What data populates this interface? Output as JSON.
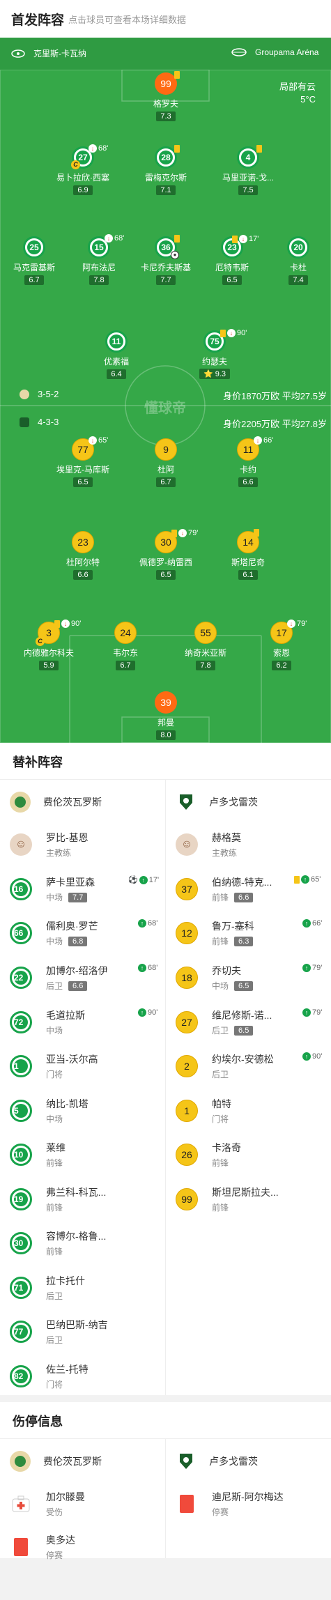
{
  "header": {
    "title": "首发阵容",
    "hint": "点击球员可查看本场详细数据"
  },
  "pitch": {
    "home_team": "克里斯-卡瓦纳",
    "venue": "Groupama Aréna",
    "weather": "局部有云",
    "temperature": "5°C",
    "watermark": "懂球帝",
    "home_formation": "3-5-2",
    "home_value": "身价1870万欧 平均27.5岁",
    "away_formation": "4-3-3",
    "away_value": "身价2205万欧 平均27.8岁",
    "colors": {
      "grass": "#35a848",
      "home": "#17a34a",
      "away": "#f5c518",
      "gk_away": "#ff6a13"
    }
  },
  "home_players": [
    {
      "num": "99",
      "name": "格罗夫",
      "rating": "7.3",
      "gk": true,
      "card": "yellow"
    },
    {
      "num": "27",
      "name": "易卜拉欣·西塞",
      "rating": "6.9",
      "sub": "68'",
      "captain": true
    },
    {
      "num": "28",
      "name": "雷梅克尔斯",
      "rating": "7.1",
      "card": "yellow"
    },
    {
      "num": "4",
      "name": "马里亚诺-戈...",
      "rating": "7.5",
      "card": "yellow"
    },
    {
      "num": "25",
      "name": "马克雷基斯",
      "rating": "6.7"
    },
    {
      "num": "15",
      "name": "阿布法尼",
      "rating": "7.8",
      "sub": "68'"
    },
    {
      "num": "36",
      "name": "卡尼乔夫斯基",
      "rating": "7.7",
      "card": "yellow",
      "goal": true
    },
    {
      "num": "23",
      "name": "厄特韦斯",
      "rating": "6.5",
      "card": "yellow",
      "sub": "17'"
    },
    {
      "num": "20",
      "name": "卡杜",
      "rating": "7.4"
    },
    {
      "num": "11",
      "name": "优素福",
      "rating": "6.4"
    },
    {
      "num": "75",
      "name": "约瑟夫",
      "rating": "9.3",
      "card": "yellow",
      "sub": "90'",
      "star": true
    }
  ],
  "away_players": [
    {
      "num": "77",
      "name": "埃里克-马库斯",
      "rating": "6.5",
      "sub": "65'"
    },
    {
      "num": "9",
      "name": "杜阿",
      "rating": "6.7"
    },
    {
      "num": "11",
      "name": "卡约",
      "rating": "6.6",
      "sub": "66'"
    },
    {
      "num": "23",
      "name": "杜阿尔特",
      "rating": "6.6"
    },
    {
      "num": "30",
      "name": "佩德罗-纳雷西",
      "rating": "6.5",
      "card": "yellow",
      "sub": "79'"
    },
    {
      "num": "14",
      "name": "斯塔尼奇",
      "rating": "6.1",
      "card": "yellow"
    },
    {
      "num": "3",
      "name": "内德雅尔科夫",
      "rating": "5.9",
      "card": "yellow",
      "sub": "90'",
      "captain": true
    },
    {
      "num": "24",
      "name": "韦尔东",
      "rating": "6.7"
    },
    {
      "num": "55",
      "name": "纳奇米亚斯",
      "rating": "7.8"
    },
    {
      "num": "17",
      "name": "索恩",
      "rating": "6.2",
      "sub": "79'"
    },
    {
      "num": "39",
      "name": "邦曼",
      "rating": "8.0",
      "gk": true
    }
  ],
  "subs": {
    "title": "替补阵容",
    "home_team": "费伦茨瓦罗斯",
    "away_team": "卢多戈雷茨",
    "home_coach": {
      "name": "罗比-基恩",
      "role": "主教练"
    },
    "away_coach": {
      "name": "赫格莫",
      "role": "主教练"
    },
    "home": [
      {
        "num": "16",
        "name": "萨卡里亚森",
        "pos": "中场",
        "rating": "7.7",
        "event": "17'",
        "goal": true
      },
      {
        "num": "66",
        "name": "儒利奥·罗芒",
        "pos": "中场",
        "rating": "6.8",
        "event": "68'"
      },
      {
        "num": "22",
        "name": "加博尔-绍洛伊",
        "pos": "后卫",
        "rating": "6.6",
        "event": "68'"
      },
      {
        "num": "72",
        "name": "毛道拉斯",
        "pos": "中场",
        "rating": "",
        "event": "90'"
      },
      {
        "num": "1",
        "name": "亚当-沃尔高",
        "pos": "门将",
        "rating": ""
      },
      {
        "num": "5",
        "name": "纳比-凯塔",
        "pos": "中场",
        "rating": ""
      },
      {
        "num": "10",
        "name": "莱维",
        "pos": "前锋",
        "rating": ""
      },
      {
        "num": "19",
        "name": "弗兰科-科瓦...",
        "pos": "前锋",
        "rating": ""
      },
      {
        "num": "30",
        "name": "容博尔-格鲁...",
        "pos": "前锋",
        "rating": ""
      },
      {
        "num": "71",
        "name": "拉卡托什",
        "pos": "后卫",
        "rating": ""
      },
      {
        "num": "77",
        "name": "巴纳巴斯-纳吉",
        "pos": "后卫",
        "rating": ""
      },
      {
        "num": "82",
        "name": "佐兰-托特",
        "pos": "门将",
        "rating": ""
      }
    ],
    "away": [
      {
        "num": "37",
        "name": "伯纳德-特克...",
        "pos": "前锋",
        "rating": "6.6",
        "event": "65'",
        "card": "yellow"
      },
      {
        "num": "12",
        "name": "鲁万-塞科",
        "pos": "前锋",
        "rating": "6.3",
        "event": "66'"
      },
      {
        "num": "18",
        "name": "乔切夫",
        "pos": "中场",
        "rating": "6.5",
        "event": "79'"
      },
      {
        "num": "27",
        "name": "维尼修斯-诺...",
        "pos": "后卫",
        "rating": "6.5",
        "event": "79'"
      },
      {
        "num": "2",
        "name": "约埃尔-安德松",
        "pos": "后卫",
        "rating": "",
        "event": "90'"
      },
      {
        "num": "1",
        "name": "帕特",
        "pos": "门将",
        "rating": ""
      },
      {
        "num": "26",
        "name": "卡洛奇",
        "pos": "前锋",
        "rating": ""
      },
      {
        "num": "99",
        "name": "斯坦尼斯拉夫...",
        "pos": "前锋",
        "rating": ""
      }
    ]
  },
  "injuries": {
    "title": "伤停信息",
    "home_team": "费伦茨瓦罗斯",
    "away_team": "卢多戈雷茨",
    "home": [
      {
        "name": "加尔滕曼",
        "status": "受伤",
        "type": "injury"
      },
      {
        "name": "奥多达",
        "status": "停赛",
        "type": "suspension"
      }
    ],
    "away": [
      {
        "name": "迪尼斯-阿尔梅达",
        "status": "停赛",
        "type": "suspension"
      }
    ]
  }
}
